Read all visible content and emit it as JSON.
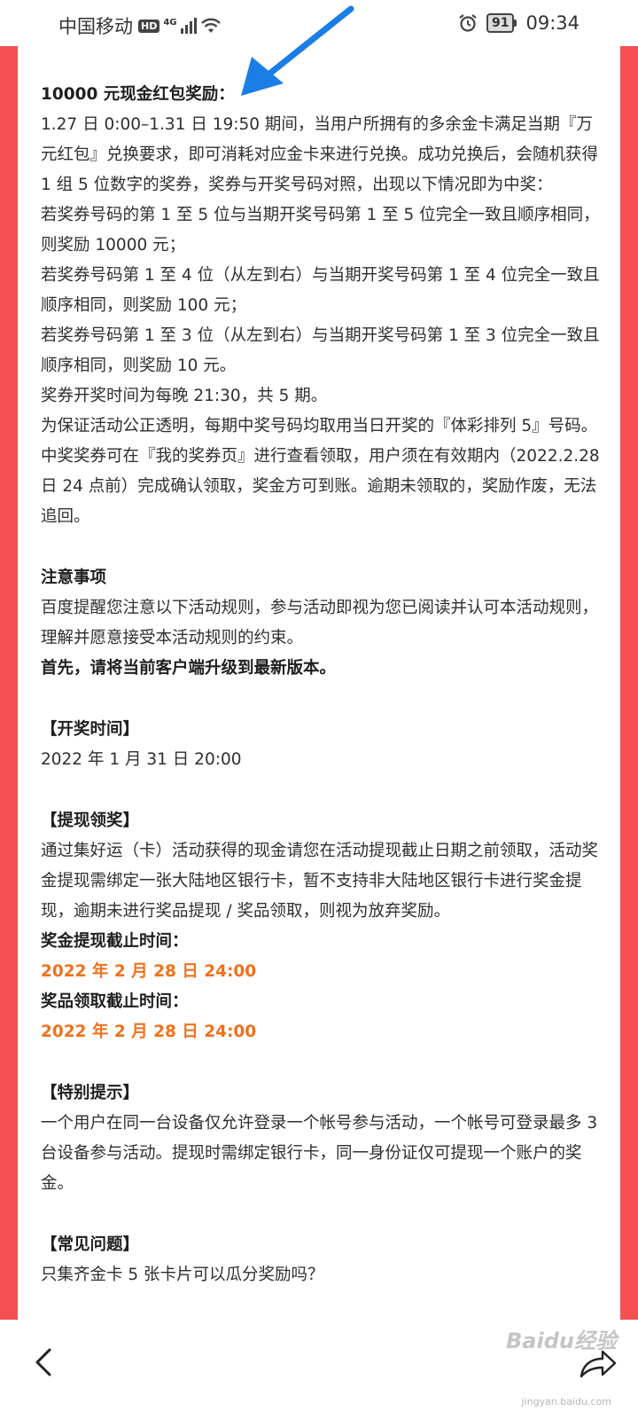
{
  "status_bar": {
    "carrier": "中国移动",
    "hd": "HD",
    "network": "4G",
    "battery": "91",
    "time": "09:34"
  },
  "content": {
    "reward_title": "10000 元现金红包奖励：",
    "reward_paragraphs": [
      "1.27 日 0:00–1.31 日 19:50 期间，当用户所拥有的多余金卡满足当期『万元红包』兑换要求，即可消耗对应金卡来进行兑换。成功兑换后，会随机获得 1 组 5 位数字的奖券，奖券与开奖号码对照，出现以下情况即为中奖：",
      "若奖券号码的第 1 至 5 位与当期开奖号码第 1 至 5 位完全一致且顺序相同，则奖励 10000 元；",
      "若奖券号码第 1 至 4 位（从左到右）与当期开奖号码第 1 至 4 位完全一致且顺序相同，则奖励 100 元；",
      "若奖券号码第 1 至 3 位（从左到右）与当期开奖号码第 1 至 3 位完全一致且顺序相同，则奖励 10 元。",
      "奖券开奖时间为每晚 21:30，共 5 期。",
      "为保证活动公正透明，每期中奖号码均取用当日开奖的『体彩排列 5』号码。",
      "中奖奖券可在『我的奖券页』进行查看领取，用户须在有效期内（2022.2.28 日 24 点前）完成确认领取，奖金方可到账。逾期未领取的，奖励作废，无法追回。"
    ],
    "notice_title": "注意事项",
    "notice_text": "百度提醒您注意以下活动规则，参与活动即视为您已阅读并认可本活动规则，理解并愿意接受本活动规则的约束。",
    "notice_bold": "首先，请将当前客户端升级到最新版本。",
    "draw_time_title": "【开奖时间】",
    "draw_time_value": "2022 年 1 月 31 日 20:00",
    "withdraw_title": "【提现领奖】",
    "withdraw_text": "通过集好运（卡）活动获得的现金请您在活动提现截止日期之前领取，活动奖金提现需绑定一张大陆地区银行卡，暂不支持非大陆地区银行卡进行奖金提现，逾期未进行奖品提现 / 奖品领取，则视为放弃奖励。",
    "cash_deadline_label": "奖金提现截止时间：",
    "cash_deadline_value": "2022 年 2 月 28 日 24:00",
    "prize_deadline_label": "奖品领取截止时间：",
    "prize_deadline_value": "2022 年 2 月 28 日 24:00",
    "special_title": "【特别提示】",
    "special_text": "一个用户在同一台设备仅允许登录一个帐号参与活动，一个帐号可登录最多 3 台设备参与活动。提现时需绑定银行卡，同一身份证仅可提现一个账户的奖金。",
    "faq_title": "【常见问题】",
    "faq_question": "只集齐金卡 5 张卡片可以瓜分奖励吗？"
  },
  "watermark": {
    "brand": "Baidu经验",
    "url": "jingyan.baidu.com"
  },
  "colors": {
    "side_bars": "#f45052",
    "highlight": "#f0711c",
    "arrow": "#1a7ee6"
  }
}
